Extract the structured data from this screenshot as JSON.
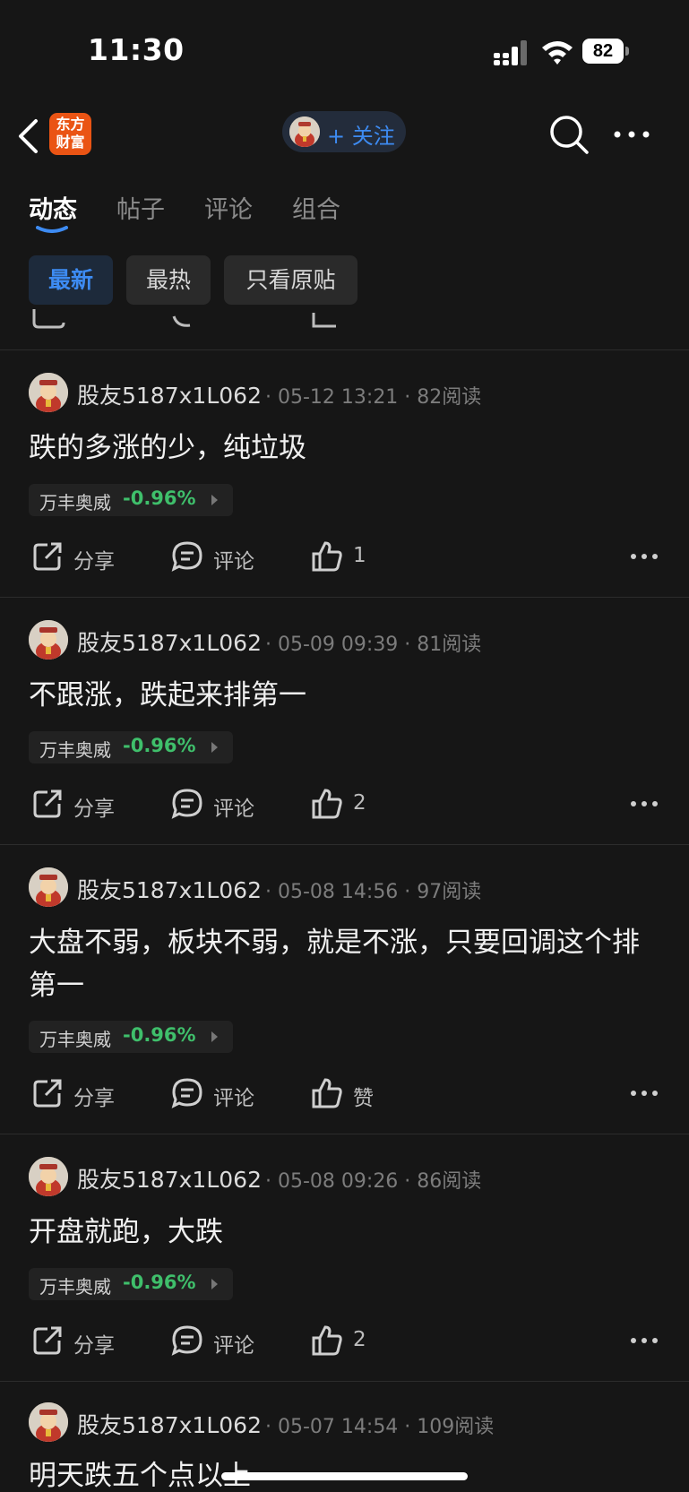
{
  "status_bar": {
    "time": "11:30",
    "battery": "82"
  },
  "nav": {
    "back_icon": "chevron-left-icon",
    "logo_line1": "东方",
    "logo_line2": "财富",
    "follow_label": "+ 关注",
    "search_icon": "search-icon",
    "more_icon": "more-horizontal-icon"
  },
  "tabs": [
    {
      "label": "动态",
      "active": true
    },
    {
      "label": "帖子",
      "active": false
    },
    {
      "label": "评论",
      "active": false
    },
    {
      "label": "组合",
      "active": false
    }
  ],
  "filters": [
    {
      "label": "最新",
      "active": true
    },
    {
      "label": "最热",
      "active": false
    },
    {
      "label": "只看原贴",
      "active": false
    }
  ],
  "actions_labels": {
    "share": "分享",
    "comment": "评论"
  },
  "posts": [
    {
      "author": "股友5187x1L062",
      "meta": "· 05-12 13:21 · 82阅读",
      "content": "跌的多涨的少，纯垃圾",
      "stock": {
        "name": "万丰奥威",
        "change": "-0.96%"
      },
      "likes": "1"
    },
    {
      "author": "股友5187x1L062",
      "meta": "· 05-09 09:39 · 81阅读",
      "content": "不跟涨，跌起来排第一",
      "stock": {
        "name": "万丰奥威",
        "change": "-0.96%"
      },
      "likes": "2"
    },
    {
      "author": "股友5187x1L062",
      "meta": "· 05-08 14:56 · 97阅读",
      "content": "大盘不弱，板块不弱，就是不涨，只要回调这个排第一",
      "stock": {
        "name": "万丰奥威",
        "change": "-0.96%"
      },
      "likes": "赞"
    },
    {
      "author": "股友5187x1L062",
      "meta": "· 05-08 09:26 · 86阅读",
      "content": "开盘就跑，大跌",
      "stock": {
        "name": "万丰奥威",
        "change": "-0.96%"
      },
      "likes": "2"
    },
    {
      "author": "股友5187x1L062",
      "meta": "· 05-07 14:54 · 109阅读",
      "content": "明天跌五个点以上"
    }
  ],
  "colors": {
    "accent": "#3d8bf2",
    "down_green": "#3fbf6b",
    "logo_orange": "#ea5414",
    "background": "#161616"
  }
}
